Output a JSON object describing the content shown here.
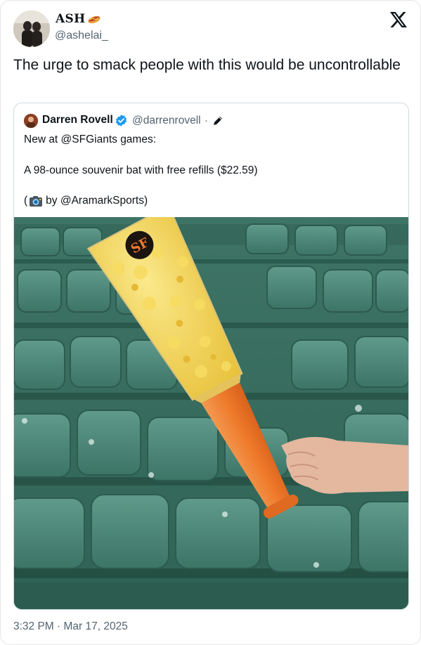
{
  "tweet": {
    "display_name": "ASH",
    "handle": "@ashelai_",
    "text": "The urge to smack people with this would be uncontrollable",
    "timestamp": "3:32 PM · Mar 17, 2025"
  },
  "quoted": {
    "display_name": "Darren Rovell",
    "handle": "@darrenrovell",
    "separator": "·",
    "line1": "New at @SFGiants games:",
    "line2": "A 98-ounce souvenir bat with free refills ($22.59)",
    "line3_open": "(",
    "line3_rest": "by @AramarkSports)"
  },
  "icons": [
    "x-logo-icon",
    "verified-badge-icon",
    "pencil-icon",
    "camera-icon",
    "hotdog-emoji-icon"
  ],
  "colors": {
    "text": "#0f1419",
    "secondary": "#536471",
    "verified": "#1d9bf0",
    "border": "#cfd9de",
    "seat_green": "#3f7d70",
    "bat_orange": "#f07a2c",
    "popcorn": "#f2d34e"
  }
}
